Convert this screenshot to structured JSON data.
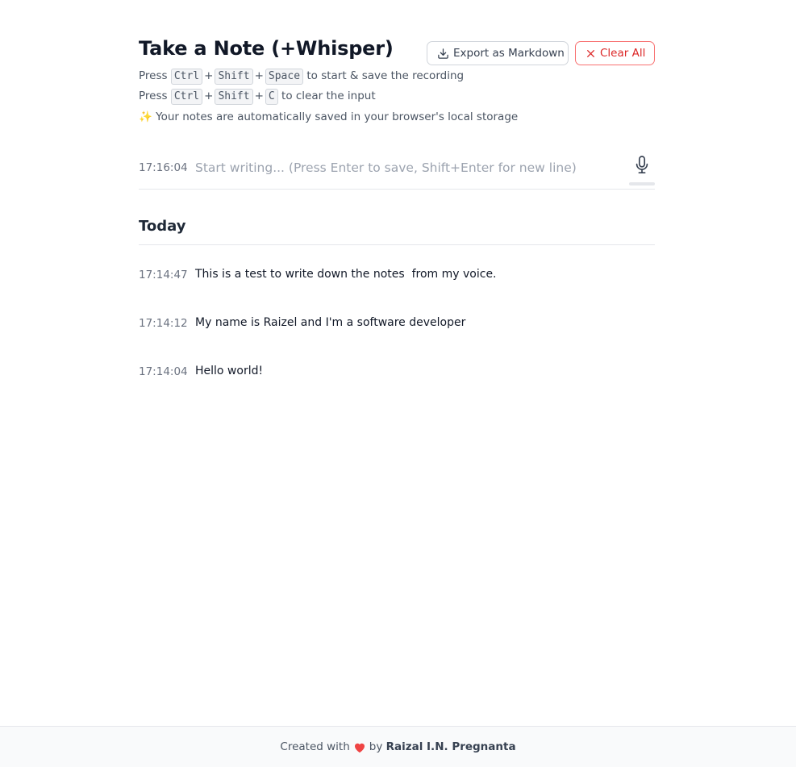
{
  "header": {
    "title": "Take a Note (+Whisper)",
    "export_label": "Export as Markdown",
    "clear_label": "Clear All"
  },
  "help": {
    "line1": {
      "prefix": "Press",
      "keys": [
        "Ctrl",
        "Shift",
        "Space"
      ],
      "suffix": "to start & save the recording"
    },
    "line2": {
      "prefix": "Press",
      "keys": [
        "Ctrl",
        "Shift",
        "C"
      ],
      "suffix": "to clear the input"
    },
    "line3": {
      "emoji": "✨",
      "text": "Your notes are automatically saved in your browser's local storage"
    },
    "plus": "+"
  },
  "input": {
    "time": "17:16:04",
    "value": "",
    "placeholder": "Start writing... (Press Enter to save, Shift+Enter for new line)"
  },
  "section": {
    "title": "Today"
  },
  "notes": [
    {
      "time": "17:14:47",
      "text": "This is a test to write down the notes  from my voice."
    },
    {
      "time": "17:14:12",
      "text": "My name is Raizel and I'm a software developer"
    },
    {
      "time": "17:14:04",
      "text": "Hello world!"
    }
  ],
  "footer": {
    "prefix": "Created with",
    "by": "by",
    "author": "Raizal I.N. Pregnanta"
  },
  "icons": {
    "export": "download-icon",
    "clear": "close-icon",
    "mic": "microphone-icon",
    "heart": "heart-icon"
  },
  "colors": {
    "danger": "#dc2626",
    "danger_border": "#f87171",
    "heart": "#ef4444",
    "muted": "#6b7280"
  }
}
